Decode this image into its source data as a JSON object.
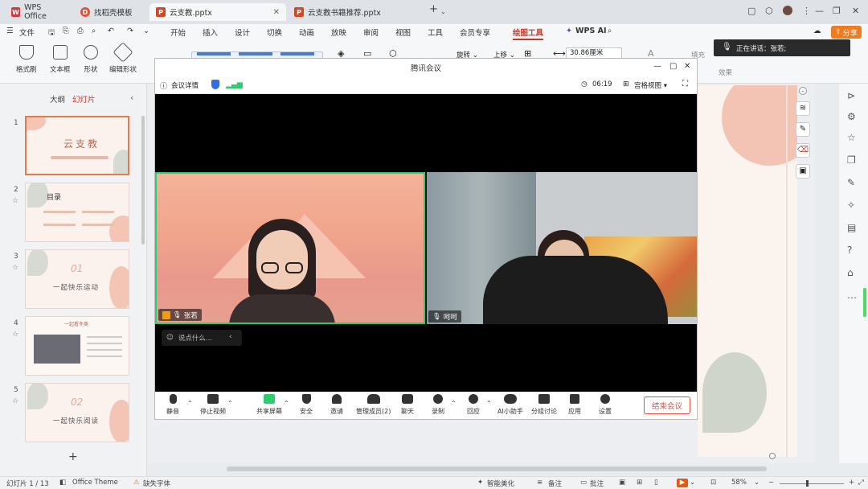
{
  "tabs": [
    {
      "label": "WPS Office",
      "icon": "wps-icon",
      "color": "#d9363e"
    },
    {
      "label": "找稻壳模板",
      "icon": "docer-icon",
      "color": "#e0523c"
    },
    {
      "label": "云支教.pptx",
      "icon": "ppt-icon",
      "color": "#d24726"
    },
    {
      "label": "云支教书籍推荐.pptx",
      "icon": "ppt-icon",
      "color": "#d24726"
    }
  ],
  "menu": {
    "file": "文件",
    "items": [
      "开始",
      "插入",
      "设计",
      "切换",
      "动画",
      "放映",
      "审阅",
      "视图",
      "工具",
      "会员专享",
      "绘图工具"
    ],
    "active": "绘图工具",
    "wps_ai": "WPS AI",
    "share": "分享"
  },
  "ribbon": {
    "format_painter": "格式刷",
    "textbox": "文本框",
    "shape": "形状",
    "edit_shape": "编辑形状",
    "rotate": "旋转",
    "move_up": "上移",
    "width_value": "30.86厘米",
    "fill": "填充",
    "effect": "效果"
  },
  "left_panel": {
    "tab_outline": "大纲",
    "tab_slides": "幻灯片",
    "add": "+",
    "slides": [
      {
        "num": "1",
        "title": "云支教"
      },
      {
        "num": "2",
        "title": "目录"
      },
      {
        "num": "3",
        "title": "一起快乐运动",
        "badge": "01"
      },
      {
        "num": "4",
        "title": "一起看冬奥"
      },
      {
        "num": "5",
        "title": "一起快乐阅读",
        "badge": "02"
      }
    ]
  },
  "meeting": {
    "title": "腾讯会议",
    "details": "会议详情",
    "timer": "06:19",
    "view_mode": "宫格视图",
    "participants": [
      {
        "name": "张若"
      },
      {
        "name": "呵呵"
      }
    ],
    "chat_placeholder": "说点什么...",
    "toolbar": [
      "静音",
      "停止视频",
      "共享屏幕",
      "安全",
      "邀请",
      "管理成员(2)",
      "聊天",
      "录制",
      "回应",
      "AI小助手",
      "分组讨论",
      "应用",
      "设置"
    ],
    "end": "结束会议"
  },
  "speaking_notice": "正在讲话：张若;",
  "status_bar": {
    "slide_info": "幻灯片 1 / 13",
    "theme": "Office Theme",
    "missing_font": "缺失字体",
    "smart_beautify": "智能美化",
    "notes": "备注",
    "comments": "批注",
    "zoom": "58%"
  }
}
